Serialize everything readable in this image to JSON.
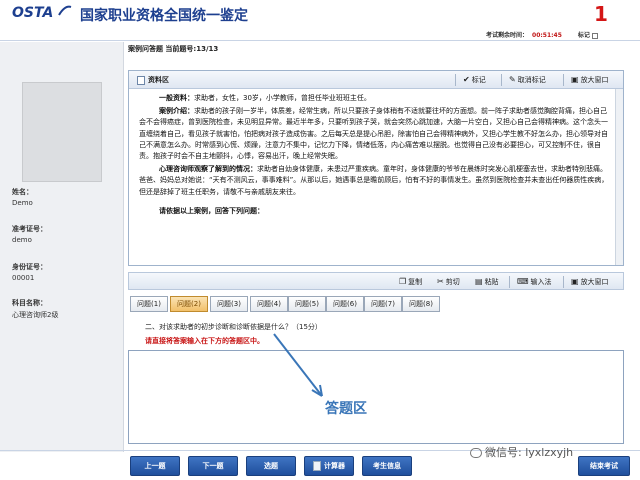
{
  "header": {
    "logo": "OSTA",
    "title": "国家职业资格全国统一鉴定",
    "question_number": "1",
    "timer_label": "考试剩余时间：",
    "timer_value": "00:51:45",
    "mark_label": "标记"
  },
  "sidebar": {
    "fields": [
      {
        "key": "姓名：",
        "value": "Demo"
      },
      {
        "key": "准考证号：",
        "value": "demo"
      },
      {
        "key": "身份证号：",
        "value": "00001"
      },
      {
        "key": "科目名称：",
        "value": "心理咨询师2级"
      }
    ]
  },
  "question_bar": {
    "label": "案例问答题 当前题号:13/13"
  },
  "material": {
    "title": "资料区",
    "toolbar": {
      "mark": "标记",
      "unmark": "取消标记",
      "enlarge": "放大窗口"
    },
    "paragraphs": [
      {
        "lead": "一般资料：",
        "text": "求助者，女性，30岁，小学教师，曾担任毕业班班主任。"
      },
      {
        "lead": "案例介绍：",
        "text": "求助者的孩子刚一岁半，体质差，经常生病，所以只要孩子身体稍有不适就要往坏的方面想。前一阵子求助者感觉胸腔背痛，担心自己会不会得癌症，曾到医院检查，未见明显异常。最近半年多，只要听到孩子哭，就会突然心跳加速，大脑一片空白，又担心自己会得精神病。这个念头一直缠绕着自己，看见孩子就害怕，怕把病对孩子造成伤害。之后每天总是提心吊胆，除害怕自己会得精神病外，又担心学生教不好怎么办，担心领导对自己不满意怎么办。时常感到心慌、烦躁，注意力不集中，记忆力下降，情绪低落，内心痛苦难以摆脱。也觉得自己没有必要担心，可又控制不住，很自责。抱孩子时会不自主地颤抖，心悸，容易出汗，晚上经常失眠。"
      },
      {
        "lead": "心理咨询师观察了解到的情况：",
        "text": "求助者自幼身体健康，未患过严重疾病。童年时，身体健康的爷爷在晨练时突发心肌梗塞去世，求助者特别悲痛。爸爸、妈妈总对她说：“天有不测风云，事事难料”。从那以后，她遇事总是瞻前顾后，怕有不好的事情发生。虽然到医院检查并未查出任何器质性疾病，但还是辞掉了班主任职务，请敬不与亲戚朋友来往。"
      }
    ],
    "prompt": "请依据以上案例，回答下列问题："
  },
  "answer_toolbar": {
    "copy": "复制",
    "cut": "剪切",
    "paste": "粘贴",
    "ime": "输入法",
    "enlarge": "放大窗口"
  },
  "tabs": [
    "问题(1)",
    "问题(2)",
    "问题(3)",
    "问题(4)",
    "问题(5)",
    "问题(6)",
    "问题(7)",
    "问题(8)"
  ],
  "question": {
    "text": "二、对该求助者的初步诊断和诊断依据是什么？（15分）",
    "hint": "请直接将答案输入在下方的答题区中。"
  },
  "answer_area": {
    "label": "答题区"
  },
  "buttons": {
    "prev": "上一题",
    "next": "下一题",
    "select": "选题",
    "calculator": "计算器",
    "candidate_info": "考生信息",
    "finish": "结束考试"
  },
  "watermark": "微信号: lyxlzxyjh",
  "colors": {
    "brand": "#1d3f8f",
    "alert": "#c81414",
    "button": "#2a5cae",
    "active_tab": "#f2c06a"
  }
}
